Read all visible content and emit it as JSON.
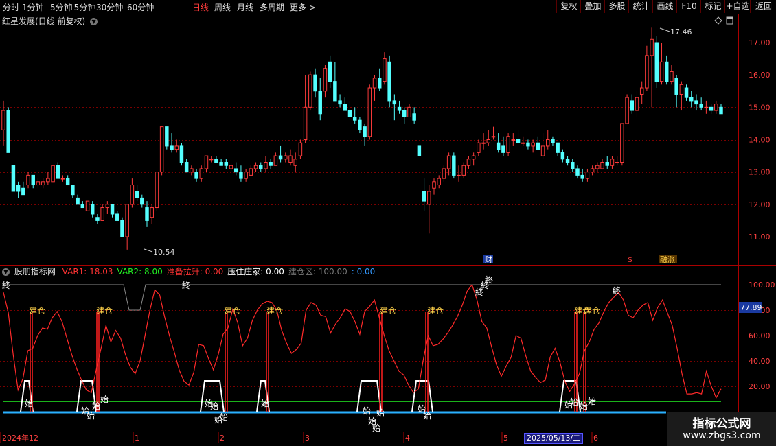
{
  "toolbar": {
    "timeframes": [
      {
        "label": "分时"
      },
      {
        "label": "1分钟"
      },
      {
        "label": "5分钟"
      },
      {
        "label": "15分钟"
      },
      {
        "label": "30分钟"
      },
      {
        "label": "60分钟"
      },
      {
        "label": "日线",
        "active": true
      },
      {
        "label": "周线"
      },
      {
        "label": "月线"
      },
      {
        "label": "多周期"
      },
      {
        "label": "更多 >"
      }
    ],
    "tools": [
      "复权",
      "叠加",
      "多股",
      "统计",
      "画线",
      "F10",
      "标记",
      "+自选",
      "返回"
    ]
  },
  "main_chart": {
    "title": "红星发展(日线 前复权)",
    "price_labels": [
      "17.00",
      "16.00",
      "15.00",
      "14.00",
      "13.00",
      "12.00",
      "11.00"
    ],
    "high_marker": "17.46",
    "low_marker": "10.54",
    "event_marks": [
      "财",
      "$",
      "融涨"
    ]
  },
  "indicator": {
    "name": "股朋指标网",
    "items": [
      {
        "label": "VAR1: 18.03",
        "color": "#ff3333"
      },
      {
        "label": "VAR2: 8.00",
        "color": "#22ee22"
      },
      {
        "label": "准备拉升: 0.00",
        "color": "#ff3333"
      },
      {
        "label": "压住庄家: 0.00",
        "color": "#ffffff"
      },
      {
        "label": "建仓区: 100.00",
        "color": "#777777"
      },
      {
        "label": ": 0.00",
        "color": "#3399ff"
      }
    ],
    "axis_labels": [
      "100.00",
      "80.00",
      "60.00",
      "40.00",
      "20.00"
    ],
    "current_value": "77.89",
    "labels": {
      "build": "建仓",
      "end": "終",
      "start": "始"
    }
  },
  "date_axis": {
    "labels": [
      "2024年12",
      "1",
      "2",
      "3",
      "4",
      "5",
      "6"
    ],
    "selected_date": "2025/05/13/二"
  },
  "watermark": {
    "line1": "指标公式网",
    "line2": "www.zbgs3.com"
  },
  "chart_data": {
    "type": "candlestick",
    "title": "红星发展(日线 前复权)",
    "price_range": [
      10.5,
      17.5
    ],
    "high": 17.46,
    "low": 10.54,
    "candles": [
      [
        14.3,
        15.2,
        13.8,
        14.9
      ],
      [
        14.9,
        15.0,
        13.6,
        13.6
      ],
      [
        13.2,
        13.2,
        12.4,
        12.4
      ],
      [
        12.6,
        12.7,
        12.2,
        12.4
      ],
      [
        12.5,
        12.7,
        12.3,
        12.3
      ],
      [
        12.6,
        13.0,
        12.5,
        12.9
      ],
      [
        12.9,
        12.9,
        12.5,
        12.6
      ],
      [
        12.6,
        12.8,
        12.5,
        12.7
      ],
      [
        12.6,
        12.8,
        12.5,
        12.7
      ],
      [
        12.7,
        13.0,
        12.6,
        12.8
      ],
      [
        12.7,
        13.2,
        12.7,
        13.2
      ],
      [
        13.2,
        13.3,
        12.8,
        12.8
      ],
      [
        12.8,
        12.9,
        12.7,
        12.8
      ],
      [
        12.8,
        12.9,
        12.6,
        12.6
      ],
      [
        12.6,
        12.6,
        12.2,
        12.3
      ],
      [
        12.2,
        12.3,
        12.0,
        12.0
      ],
      [
        12.0,
        12.1,
        11.9,
        11.9
      ],
      [
        11.8,
        12.1,
        11.8,
        12.1
      ],
      [
        12.0,
        12.1,
        11.6,
        11.7
      ],
      [
        11.6,
        11.7,
        11.4,
        11.5
      ],
      [
        11.5,
        12.0,
        11.5,
        11.9
      ],
      [
        11.9,
        12.1,
        11.7,
        12.0
      ],
      [
        12.0,
        12.0,
        11.6,
        11.7
      ],
      [
        11.7,
        11.8,
        11.5,
        11.5
      ],
      [
        11.5,
        11.6,
        11.0,
        11.0
      ],
      [
        11.0,
        12.0,
        10.6,
        12.0
      ],
      [
        12.0,
        12.8,
        11.9,
        12.6
      ],
      [
        12.4,
        12.6,
        12.1,
        12.2
      ],
      [
        12.2,
        12.3,
        11.9,
        12.0
      ],
      [
        11.9,
        12.1,
        11.3,
        11.5
      ],
      [
        11.6,
        12.0,
        11.4,
        11.9
      ],
      [
        11.9,
        13.0,
        11.8,
        13.0
      ],
      [
        13.0,
        14.4,
        12.9,
        14.4
      ],
      [
        14.4,
        14.4,
        13.7,
        13.8
      ],
      [
        13.8,
        14.2,
        13.6,
        13.7
      ],
      [
        13.7,
        14.0,
        13.6,
        13.8
      ],
      [
        13.8,
        13.9,
        13.2,
        13.3
      ],
      [
        13.3,
        13.4,
        13.0,
        13.0
      ],
      [
        13.0,
        13.2,
        12.9,
        13.1
      ],
      [
        13.0,
        13.1,
        12.7,
        12.8
      ],
      [
        12.8,
        13.2,
        12.7,
        13.1
      ],
      [
        13.1,
        13.5,
        13.0,
        13.5
      ],
      [
        13.4,
        13.5,
        13.3,
        13.4
      ],
      [
        13.4,
        13.5,
        13.3,
        13.3
      ],
      [
        13.3,
        13.4,
        13.2,
        13.2
      ],
      [
        13.3,
        13.4,
        13.1,
        13.2
      ],
      [
        13.1,
        13.3,
        13.0,
        13.2
      ],
      [
        13.1,
        13.3,
        12.9,
        13.0
      ],
      [
        13.0,
        13.2,
        12.7,
        12.8
      ],
      [
        12.8,
        13.1,
        12.7,
        13.0
      ],
      [
        12.9,
        13.2,
        12.9,
        13.1
      ],
      [
        13.1,
        13.3,
        13.0,
        13.2
      ],
      [
        13.2,
        13.3,
        13.0,
        13.1
      ],
      [
        13.1,
        13.5,
        13.0,
        13.3
      ],
      [
        13.3,
        13.4,
        13.1,
        13.2
      ],
      [
        13.2,
        13.6,
        13.2,
        13.5
      ],
      [
        13.5,
        13.8,
        13.3,
        13.4
      ],
      [
        13.4,
        13.6,
        13.3,
        13.5
      ],
      [
        13.3,
        13.7,
        13.2,
        13.5
      ],
      [
        13.2,
        13.6,
        13.0,
        13.4
      ],
      [
        13.5,
        14.0,
        13.4,
        13.9
      ],
      [
        14.0,
        16.0,
        13.9,
        15.0
      ],
      [
        15.0,
        16.1,
        14.9,
        16.0
      ],
      [
        16.0,
        16.2,
        15.3,
        15.5
      ],
      [
        15.5,
        15.9,
        14.6,
        14.8
      ],
      [
        15.5,
        16.3,
        15.3,
        16.2
      ],
      [
        16.4,
        16.6,
        15.6,
        15.8
      ],
      [
        15.8,
        16.4,
        15.2,
        15.2
      ],
      [
        15.2,
        15.4,
        15.0,
        15.1
      ],
      [
        15.1,
        15.3,
        14.9,
        14.9
      ],
      [
        14.9,
        15.2,
        14.6,
        14.7
      ],
      [
        14.7,
        15.0,
        14.5,
        14.6
      ],
      [
        14.6,
        14.7,
        14.2,
        14.3
      ],
      [
        14.4,
        14.5,
        13.8,
        14.1
      ],
      [
        14.1,
        15.7,
        14.0,
        15.6
      ],
      [
        15.6,
        16.0,
        15.2,
        15.9
      ],
      [
        15.9,
        16.2,
        15.5,
        15.6
      ],
      [
        15.8,
        16.7,
        15.7,
        16.5
      ],
      [
        16.4,
        16.6,
        15.0,
        15.2
      ],
      [
        15.2,
        15.4,
        14.6,
        15.1
      ],
      [
        15.0,
        15.2,
        14.8,
        14.9
      ],
      [
        14.9,
        15.0,
        14.5,
        14.7
      ],
      [
        14.7,
        15.1,
        14.7,
        15.0
      ],
      [
        14.8,
        15.0,
        14.5,
        14.6
      ],
      [
        13.8,
        13.7,
        13.5,
        13.5
      ],
      [
        12.4,
        12.8,
        11.8,
        12.1
      ],
      [
        12.0,
        12.6,
        11.1,
        12.4
      ],
      [
        12.5,
        12.8,
        12.3,
        12.7
      ],
      [
        12.6,
        12.9,
        12.5,
        12.8
      ],
      [
        12.8,
        13.2,
        12.7,
        13.1
      ],
      [
        13.1,
        13.6,
        12.9,
        13.5
      ],
      [
        13.5,
        13.6,
        12.8,
        12.9
      ],
      [
        12.9,
        13.2,
        12.7,
        12.9
      ],
      [
        12.9,
        13.3,
        12.8,
        13.2
      ],
      [
        13.2,
        13.5,
        13.1,
        13.4
      ],
      [
        13.4,
        13.6,
        13.2,
        13.5
      ],
      [
        13.6,
        14.0,
        13.5,
        13.9
      ],
      [
        13.9,
        14.2,
        13.7,
        13.9
      ],
      [
        13.9,
        14.3,
        13.8,
        14.0
      ],
      [
        14.1,
        14.4,
        14.0,
        14.1
      ],
      [
        13.9,
        14.2,
        13.6,
        13.7
      ],
      [
        13.8,
        14.1,
        13.5,
        13.6
      ],
      [
        13.6,
        14.2,
        13.5,
        14.1
      ],
      [
        14.0,
        14.2,
        13.8,
        14.0
      ],
      [
        14.0,
        14.3,
        13.9,
        13.9
      ],
      [
        13.9,
        14.1,
        13.8,
        13.9
      ],
      [
        13.9,
        14.0,
        13.7,
        13.8
      ],
      [
        13.8,
        14.0,
        13.6,
        13.9
      ],
      [
        13.9,
        14.1,
        13.7,
        13.7
      ],
      [
        13.5,
        14.2,
        13.4,
        13.8
      ],
      [
        13.8,
        14.3,
        13.7,
        14.0
      ],
      [
        14.0,
        14.1,
        13.8,
        13.9
      ],
      [
        13.9,
        13.9,
        13.5,
        13.6
      ],
      [
        13.6,
        13.7,
        13.3,
        13.4
      ],
      [
        13.4,
        13.5,
        13.2,
        13.3
      ],
      [
        13.3,
        13.4,
        13.0,
        13.1
      ],
      [
        13.1,
        13.2,
        12.8,
        12.9
      ],
      [
        12.9,
        13.1,
        12.7,
        12.8
      ],
      [
        12.8,
        13.1,
        12.7,
        13.0
      ],
      [
        13.0,
        13.2,
        12.9,
        13.1
      ],
      [
        13.1,
        13.3,
        13.0,
        13.2
      ],
      [
        13.1,
        13.4,
        13.1,
        13.3
      ],
      [
        13.3,
        13.5,
        13.1,
        13.2
      ],
      [
        13.2,
        13.5,
        13.1,
        13.4
      ],
      [
        13.3,
        13.5,
        13.2,
        13.3
      ],
      [
        13.3,
        14.5,
        13.2,
        14.5
      ],
      [
        14.5,
        15.4,
        14.5,
        15.3
      ],
      [
        15.2,
        15.4,
        14.8,
        14.9
      ],
      [
        14.9,
        15.5,
        14.7,
        15.3
      ],
      [
        15.4,
        15.8,
        15.1,
        15.6
      ],
      [
        15.6,
        16.9,
        15.5,
        16.6
      ],
      [
        16.6,
        17.46,
        15.0,
        17.1
      ],
      [
        17.0,
        17.2,
        15.6,
        15.8
      ],
      [
        15.8,
        17.0,
        15.7,
        16.4
      ],
      [
        16.4,
        16.6,
        15.7,
        15.8
      ],
      [
        15.8,
        16.3,
        15.7,
        16.1
      ],
      [
        15.9,
        16.0,
        15.0,
        15.4
      ],
      [
        15.4,
        15.8,
        14.9,
        15.7
      ],
      [
        15.6,
        15.7,
        15.2,
        15.3
      ],
      [
        15.3,
        15.5,
        15.0,
        15.2
      ],
      [
        15.2,
        15.4,
        14.9,
        15.1
      ],
      [
        15.1,
        15.3,
        14.9,
        15.0
      ],
      [
        15.0,
        15.2,
        14.8,
        15.0
      ],
      [
        15.0,
        15.1,
        14.8,
        14.9
      ],
      [
        14.9,
        15.2,
        14.8,
        15.1
      ],
      [
        15.0,
        15.1,
        14.8,
        14.8
      ]
    ],
    "indicator_range": [
      0,
      100
    ],
    "var1": [
      94,
      78,
      45,
      17,
      26,
      48,
      50,
      60,
      66,
      65,
      74,
      79,
      71,
      58,
      45,
      34,
      25,
      17,
      15,
      33,
      50,
      68,
      55,
      64,
      58,
      45,
      35,
      30,
      40,
      60,
      80,
      96,
      92,
      75,
      60,
      47,
      33,
      24,
      21,
      31,
      53,
      52,
      42,
      33,
      45,
      61,
      66,
      81,
      70,
      52,
      58,
      72,
      80,
      85,
      87,
      86,
      80,
      64,
      54,
      46,
      49,
      54,
      80,
      86,
      84,
      76,
      75,
      62,
      69,
      74,
      81,
      79,
      71,
      61,
      79,
      83,
      88,
      74,
      60,
      48,
      40,
      32,
      29,
      21,
      15,
      18,
      41,
      60,
      52,
      53,
      57,
      62,
      68,
      75,
      84,
      95,
      100,
      88,
      71,
      66,
      51,
      37,
      28,
      36,
      43,
      60,
      58,
      44,
      32,
      27,
      23,
      25,
      43,
      50,
      39,
      24,
      16,
      22,
      30,
      48,
      55,
      65,
      70,
      79,
      86,
      90,
      94,
      88,
      76,
      74,
      80,
      84,
      86,
      72,
      82,
      88,
      78,
      68,
      50,
      30,
      14,
      14,
      15,
      14,
      32,
      20,
      11,
      18
    ],
    "var2": 8,
    "reference_level": 100,
    "blue_level": 0
  }
}
